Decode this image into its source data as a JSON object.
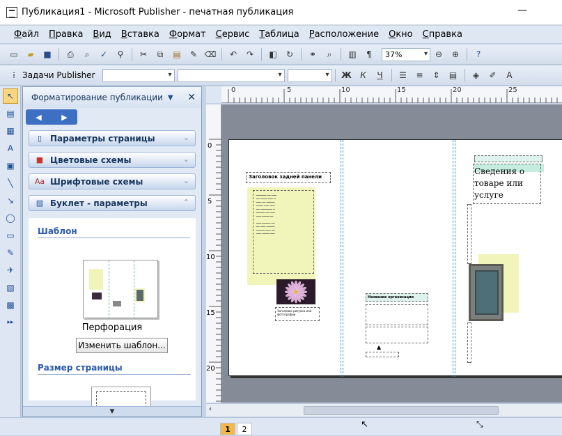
{
  "window": {
    "title": "Публикация1 - Microsoft Publisher - печатная публикация",
    "minimize_glyph": "—"
  },
  "menu": [
    "Файл",
    "Правка",
    "Вид",
    "Вставка",
    "Формат",
    "Сервис",
    "Таблица",
    "Расположение",
    "Окно",
    "Справка"
  ],
  "standard_toolbar": {
    "zoom": "37%"
  },
  "formatting_toolbar": {
    "tasks_label": "Задачи Publisher",
    "bold": "Ж",
    "italic": "К",
    "underline": "Ч"
  },
  "taskpane": {
    "title": "Форматирование публикации",
    "sections": [
      {
        "label": "Параметры страницы",
        "icon": "page-icon"
      },
      {
        "label": "Цветовые схемы",
        "icon": "color-swatch-icon"
      },
      {
        "label": "Шрифтовые схемы",
        "icon": "font-icon"
      },
      {
        "label": "Буклет - параметры",
        "icon": "booklet-icon"
      }
    ],
    "template_heading": "Шаблон",
    "template_name": "Перфорация",
    "change_template_button": "Изменить шаблон...",
    "page_size_heading": "Размер страницы"
  },
  "ruler": {
    "h_labels": [
      "0",
      "5",
      "10",
      "15",
      "20",
      "25"
    ],
    "v_labels": [
      "0",
      "5",
      "10",
      "15",
      "20"
    ]
  },
  "document": {
    "panel_heading": "Заголовок задней панели",
    "org_name": "Название организации",
    "product_text": "Сведения о товаре или услуге",
    "picture_caption": "Заголовок рисунка или фотографии"
  },
  "status": {
    "pages": [
      "1",
      "2"
    ],
    "active_page": "1"
  }
}
